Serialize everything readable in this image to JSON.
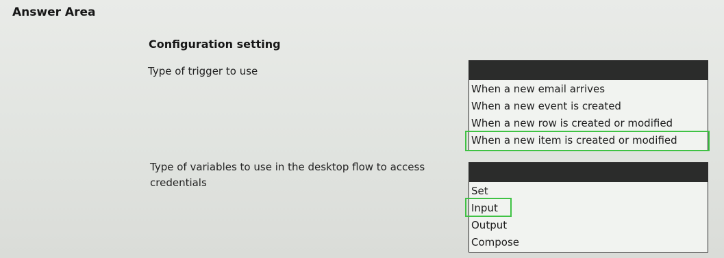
{
  "answer_area": {
    "title": "Answer Area"
  },
  "config": {
    "header": "Configuration setting"
  },
  "questions": [
    {
      "label": "Type of trigger to use",
      "options": [
        "When a new email arrives",
        "When a new event is created",
        "When a new row is created or modified",
        "When a new item is created or modified"
      ],
      "selected": "When a new item is created or modified"
    },
    {
      "label": "Type of variables to use in the desktop flow to access credentials",
      "options": [
        "Set",
        "Input",
        "Output",
        "Compose"
      ],
      "selected": "Input"
    }
  ],
  "colors": {
    "highlight": "#3fc244",
    "dropdown_header": "#2b2c2b"
  }
}
